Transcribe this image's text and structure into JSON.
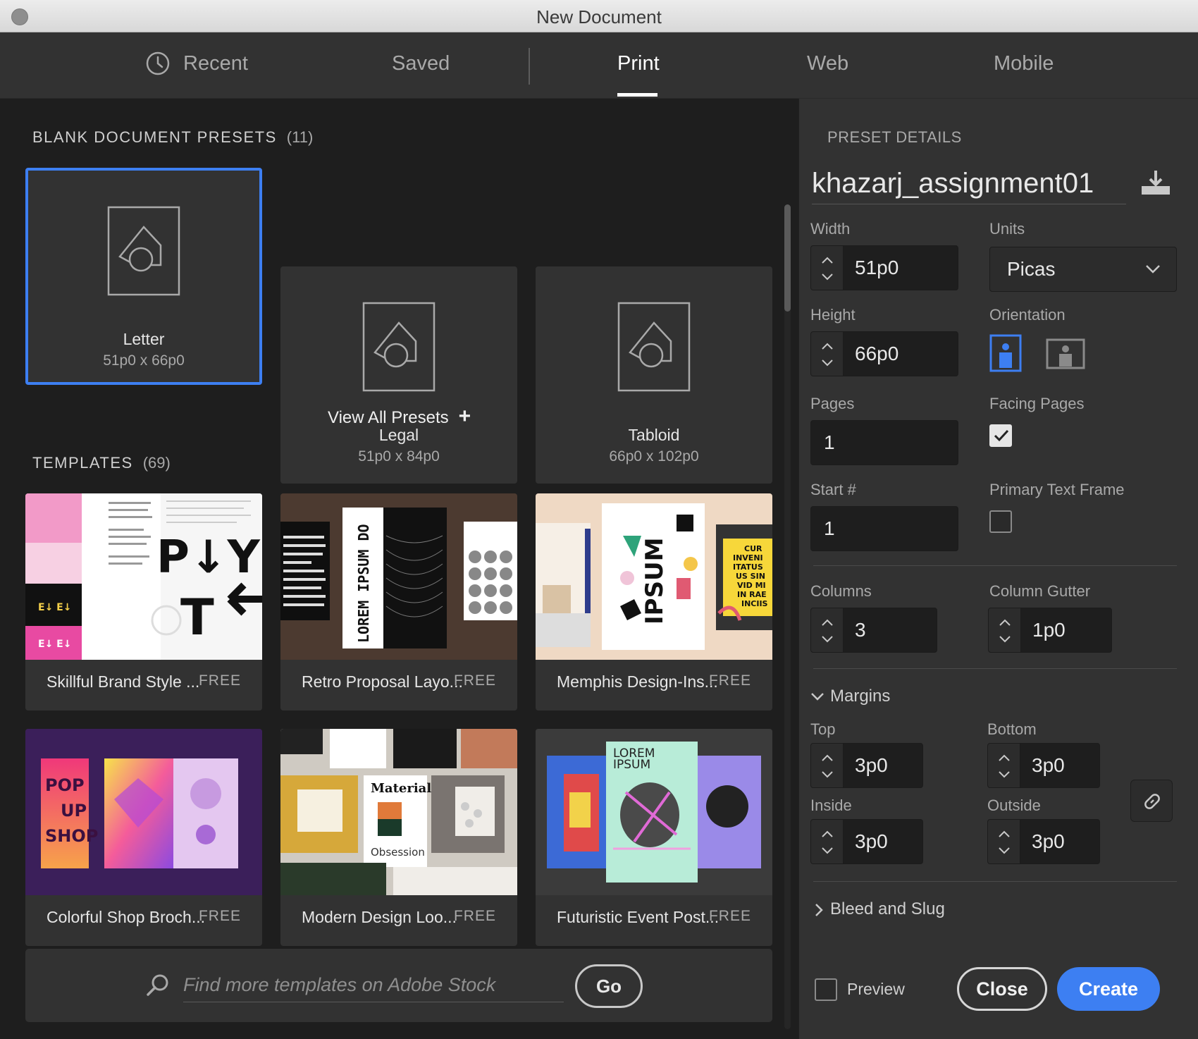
{
  "window": {
    "title": "New Document"
  },
  "tabs": [
    {
      "label": "Recent",
      "icon": "clock-icon"
    },
    {
      "label": "Saved"
    },
    {
      "label": "Print",
      "active": true
    },
    {
      "label": "Web"
    },
    {
      "label": "Mobile"
    }
  ],
  "blank_presets": {
    "heading": "BLANK DOCUMENT PRESETS",
    "count": "(11)",
    "items": [
      {
        "name": "Letter",
        "size": "51p0 x 66p0",
        "selected": true
      },
      {
        "name": "Legal",
        "size": "51p0 x 84p0"
      },
      {
        "name": "Tabloid",
        "size": "66p0 x 102p0"
      }
    ],
    "view_all_label": "View All Presets",
    "view_all_icon": "+"
  },
  "templates": {
    "heading": "TEMPLATES",
    "count": "(69)",
    "items": [
      {
        "name": "Skillful Brand Style ...",
        "price": "FREE"
      },
      {
        "name": "Retro Proposal Layo...",
        "price": "FREE"
      },
      {
        "name": "Memphis Design-Ins...",
        "price": "FREE"
      },
      {
        "name": "Colorful Shop Broch...",
        "price": "FREE"
      },
      {
        "name": "Modern Design Loo...",
        "price": "FREE"
      },
      {
        "name": "Futuristic Event Post...",
        "price": "FREE"
      }
    ],
    "thumb_text": {
      "t2_lorem": "LOREM IPSUM DO",
      "t3_ipsum": "IPSUM",
      "t4_pop": "POP",
      "t4_up": "UP",
      "t4_shop": "SHOP",
      "t5_material": "Material",
      "t5_obsession": "Obsession",
      "t6_lorem": "LOREM",
      "t6_ipsum": "IPSUM"
    }
  },
  "search": {
    "placeholder": "Find more templates on Adobe Stock",
    "go_label": "Go"
  },
  "preset_details": {
    "heading": "PRESET DETAILS",
    "document_name": "khazarj_assignment01",
    "width_label": "Width",
    "width_value": "51p0",
    "units_label": "Units",
    "units_value": "Picas",
    "height_label": "Height",
    "height_value": "66p0",
    "orientation_label": "Orientation",
    "orientation_value": "portrait",
    "pages_label": "Pages",
    "pages_value": "1",
    "facing_pages_label": "Facing Pages",
    "facing_pages_checked": true,
    "start_label": "Start #",
    "start_value": "1",
    "primary_text_frame_label": "Primary Text Frame",
    "primary_text_frame_checked": false,
    "columns_label": "Columns",
    "columns_value": "3",
    "gutter_label": "Column Gutter",
    "gutter_value": "1p0",
    "margins_label": "Margins",
    "margins": {
      "top_label": "Top",
      "top_value": "3p0",
      "bottom_label": "Bottom",
      "bottom_value": "3p0",
      "inside_label": "Inside",
      "inside_value": "3p0",
      "outside_label": "Outside",
      "outside_value": "3p0"
    },
    "bleed_label": "Bleed and Slug"
  },
  "footer": {
    "preview_label": "Preview",
    "preview_checked": false,
    "close_label": "Close",
    "create_label": "Create"
  },
  "colors": {
    "accent": "#3d7ff2",
    "panel": "#323232",
    "background": "#1e1e1e"
  }
}
